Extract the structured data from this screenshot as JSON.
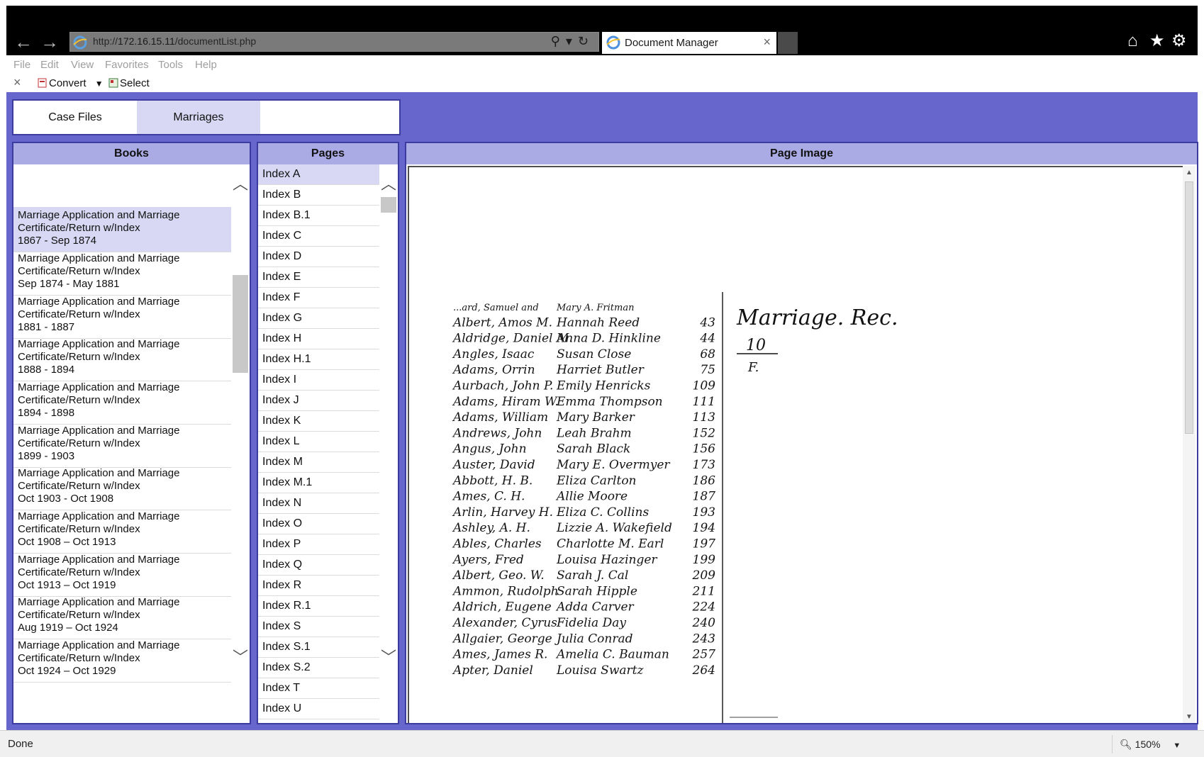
{
  "browser": {
    "url_prefix": "http://",
    "url_host": "172.16.15.11",
    "url_path": "/documentList.php",
    "tab_title": "Document Manager",
    "tab_close": "×",
    "back": "←",
    "forward": "→"
  },
  "menu": [
    "File",
    "Edit",
    "View",
    "Favorites",
    "Tools",
    "Help"
  ],
  "commandbar": {
    "close": "×",
    "convert": "Convert",
    "select": "Select"
  },
  "tabs": [
    {
      "label": "Case Files"
    },
    {
      "label": "Marriages"
    }
  ],
  "books": {
    "header": "Books",
    "items": [
      {
        "line1": "Marriage Application and Marriage",
        "line2": "Certificate/Return w/Index",
        "line3": "1867 - Sep 1874"
      },
      {
        "line1": "Marriage Application and Marriage",
        "line2": "Certificate/Return w/Index",
        "line3": "Sep 1874 - May 1881"
      },
      {
        "line1": "Marriage Application and Marriage",
        "line2": "Certificate/Return w/Index",
        "line3": "1881 - 1887"
      },
      {
        "line1": "Marriage Application and Marriage",
        "line2": "Certificate/Return w/Index",
        "line3": "1888 - 1894"
      },
      {
        "line1": "Marriage Application and Marriage",
        "line2": "Certificate/Return w/Index",
        "line3": "1894 - 1898"
      },
      {
        "line1": "Marriage Application and Marriage",
        "line2": "Certificate/Return w/Index",
        "line3": "1899 - 1903"
      },
      {
        "line1": "Marriage Application and Marriage",
        "line2": "Certificate/Return w/Index",
        "line3": "Oct 1903 - Oct 1908"
      },
      {
        "line1": "Marriage Application and Marriage",
        "line2": "Certificate/Return w/Index",
        "line3": "Oct 1908 – Oct 1913"
      },
      {
        "line1": "Marriage Application and Marriage",
        "line2": "Certificate/Return w/Index",
        "line3": "Oct 1913 – Oct 1919"
      },
      {
        "line1": "Marriage Application and Marriage",
        "line2": "Certificate/Return w/Index",
        "line3": "Aug 1919 – Oct 1924"
      },
      {
        "line1": "Marriage Application and Marriage",
        "line2": "Certificate/Return w/Index",
        "line3": "Oct 1924 – Oct 1929"
      }
    ]
  },
  "pages": {
    "header": "Pages",
    "items": [
      "Index A",
      "Index B",
      "Index B.1",
      "Index C",
      "Index D",
      "Index E",
      "Index F",
      "Index G",
      "Index H",
      "Index H.1",
      "Index I",
      "Index J",
      "Index K",
      "Index L",
      "Index M",
      "Index M.1",
      "Index N",
      "Index O",
      "Index P",
      "Index Q",
      "Index R",
      "Index R.1",
      "Index S",
      "Index S.1",
      "Index S.2",
      "Index T",
      "Index U"
    ]
  },
  "page_image": {
    "header": "Page Image",
    "heading": "Marriage. Rec.",
    "fraction_top": "10",
    "fraction_bottom": "F.",
    "rows": [
      {
        "groom": "...ard, Samuel and",
        "bride": "Mary A. Fritman",
        "num": ""
      },
      {
        "groom": "Albert, Amos M.",
        "bride": "Hannah Reed",
        "num": "43"
      },
      {
        "groom": "Aldridge, Daniel M.",
        "bride": "Anna D. Hinkline",
        "num": "44"
      },
      {
        "groom": "Angles, Isaac",
        "bride": "Susan Close",
        "num": "68"
      },
      {
        "groom": "Adams, Orrin",
        "bride": "Harriet Butler",
        "num": "75"
      },
      {
        "groom": "Aurbach, John P.",
        "bride": "Emily Henricks",
        "num": "109"
      },
      {
        "groom": "Adams, Hiram W.",
        "bride": "Emma Thompson",
        "num": "111"
      },
      {
        "groom": "Adams, William",
        "bride": "Mary Barker",
        "num": "113"
      },
      {
        "groom": "Andrews, John",
        "bride": "Leah Brahm",
        "num": "152"
      },
      {
        "groom": "Angus, John",
        "bride": "Sarah Black",
        "num": "156"
      },
      {
        "groom": "Auster, David",
        "bride": "Mary E. Overmyer",
        "num": "173"
      },
      {
        "groom": "Abbott, H. B.",
        "bride": "Eliza Carlton",
        "num": "186"
      },
      {
        "groom": "Ames, C. H.",
        "bride": "Allie Moore",
        "num": "187"
      },
      {
        "groom": "Arlin, Harvey H.",
        "bride": "Eliza C. Collins",
        "num": "193"
      },
      {
        "groom": "Ashley, A. H.",
        "bride": "Lizzie A. Wakefield",
        "num": "194"
      },
      {
        "groom": "Ables, Charles",
        "bride": "Charlotte M. Earl",
        "num": "197"
      },
      {
        "groom": "Ayers, Fred",
        "bride": "Louisa Hazinger",
        "num": "199"
      },
      {
        "groom": "Albert, Geo. W.",
        "bride": "Sarah J. Cal",
        "num": "209"
      },
      {
        "groom": "Ammon, Rudolph",
        "bride": "Sarah Hipple",
        "num": "211"
      },
      {
        "groom": "Aldrich, Eugene",
        "bride": "Adda Carver",
        "num": "224"
      },
      {
        "groom": "Alexander, Cyrus",
        "bride": "Fidelia Day",
        "num": "240"
      },
      {
        "groom": "Allgaier, George",
        "bride": "Julia Conrad",
        "num": "243"
      },
      {
        "groom": "Ames, James R.",
        "bride": "Amelia C. Bauman",
        "num": "257"
      },
      {
        "groom": "Apter, Daniel",
        "bride": "Louisa Swartz",
        "num": "264"
      }
    ]
  },
  "status": {
    "text": "Done",
    "zoom": "150%"
  }
}
